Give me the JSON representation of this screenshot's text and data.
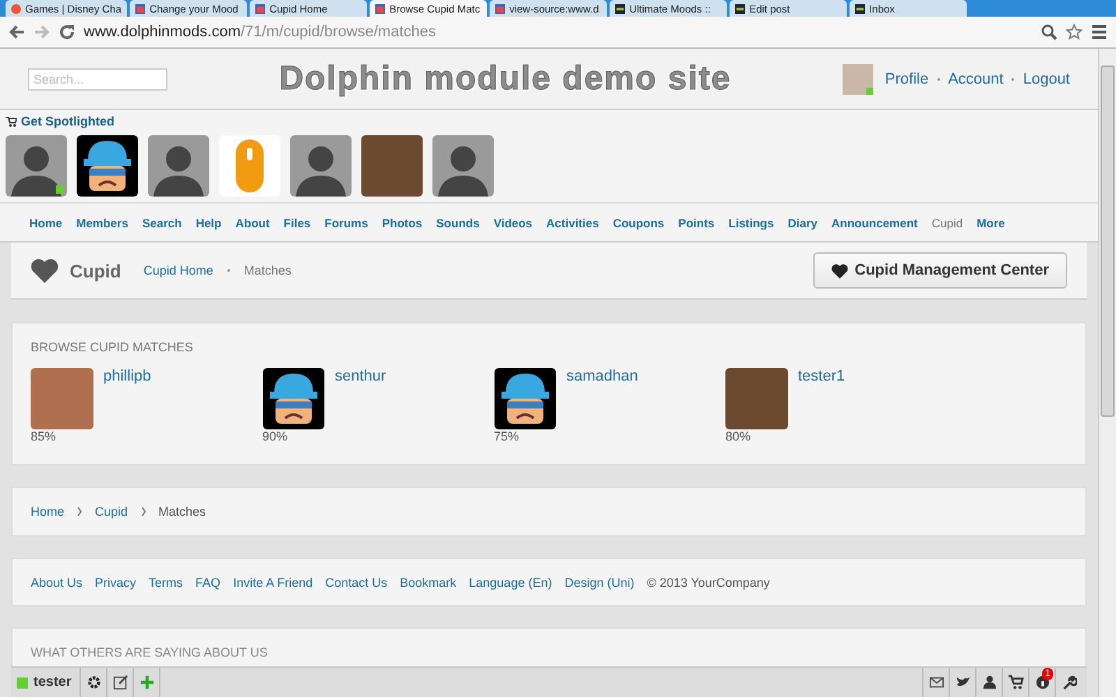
{
  "browser": {
    "tabs": [
      {
        "title": "Games | Disney Cha",
        "kind": "round",
        "selected": false
      },
      {
        "title": "Change your Mood",
        "kind": "page",
        "selected": false
      },
      {
        "title": "Cupid Home",
        "kind": "page",
        "selected": false
      },
      {
        "title": "Browse Cupid Matc",
        "kind": "page",
        "selected": true
      },
      {
        "title": "view-source:www.d",
        "kind": "page",
        "selected": false
      },
      {
        "title": "Ultimate Moods ::",
        "kind": "dark",
        "selected": false
      },
      {
        "title": "Edit post",
        "kind": "dark",
        "selected": false
      },
      {
        "title": "Inbox",
        "kind": "dark",
        "selected": false
      }
    ],
    "address": {
      "host": "www.dolphinmods.com",
      "path": "/71/m/cupid/browse/matches"
    }
  },
  "header": {
    "search_placeholder": "Search...",
    "site_title": "Dolphin module demo site",
    "user_online": true,
    "links": [
      "Profile",
      "Account",
      "Logout"
    ]
  },
  "spotlight": {
    "title": "Get Spotlighted",
    "members": [
      {
        "kind": "silhouette",
        "online": true
      },
      {
        "kind": "cartoon",
        "online": false
      },
      {
        "kind": "silhouette",
        "online": false
      },
      {
        "kind": "mouse",
        "online": false
      },
      {
        "kind": "silhouette",
        "online": false
      },
      {
        "kind": "photo",
        "online": false
      },
      {
        "kind": "silhouette",
        "online": false
      }
    ]
  },
  "nav": [
    {
      "label": "Home",
      "selected": false
    },
    {
      "label": "Members",
      "selected": false
    },
    {
      "label": "Search",
      "selected": false
    },
    {
      "label": "Help",
      "selected": false
    },
    {
      "label": "About",
      "selected": false
    },
    {
      "label": "Files",
      "selected": false
    },
    {
      "label": "Forums",
      "selected": false
    },
    {
      "label": "Photos",
      "selected": false
    },
    {
      "label": "Sounds",
      "selected": false
    },
    {
      "label": "Videos",
      "selected": false
    },
    {
      "label": "Activities",
      "selected": false
    },
    {
      "label": "Coupons",
      "selected": false
    },
    {
      "label": "Points",
      "selected": false
    },
    {
      "label": "Listings",
      "selected": false
    },
    {
      "label": "Diary",
      "selected": false
    },
    {
      "label": "Announcement",
      "selected": false
    },
    {
      "label": "Cupid",
      "selected": true
    },
    {
      "label": "More",
      "selected": false
    }
  ],
  "page_header": {
    "title": "Cupid",
    "breadcrumb": [
      "Cupid Home",
      "Matches"
    ],
    "button": "Cupid Management Center"
  },
  "matches": {
    "title": "BROWSE CUPID MATCHES",
    "items": [
      {
        "name": "phillipb",
        "percent": "85%",
        "kind": "dog"
      },
      {
        "name": "senthur",
        "percent": "90%",
        "kind": "cartoon"
      },
      {
        "name": "samadhan",
        "percent": "75%",
        "kind": "cartoon"
      },
      {
        "name": "tester1",
        "percent": "80%",
        "kind": "photo"
      }
    ]
  },
  "breadcrumb": [
    "Home",
    "Cupid",
    "Matches"
  ],
  "footer": {
    "links": [
      "About Us",
      "Privacy",
      "Terms",
      "FAQ",
      "Invite A Friend",
      "Contact Us",
      "Bookmark",
      "Language (En)",
      "Design (Uni)"
    ],
    "copyright": "© 2013 YourCompany"
  },
  "others_title": "WHAT OTHERS ARE SAYING ABOUT US",
  "toolbar": {
    "user": "tester",
    "online": true,
    "notifications": "1"
  }
}
